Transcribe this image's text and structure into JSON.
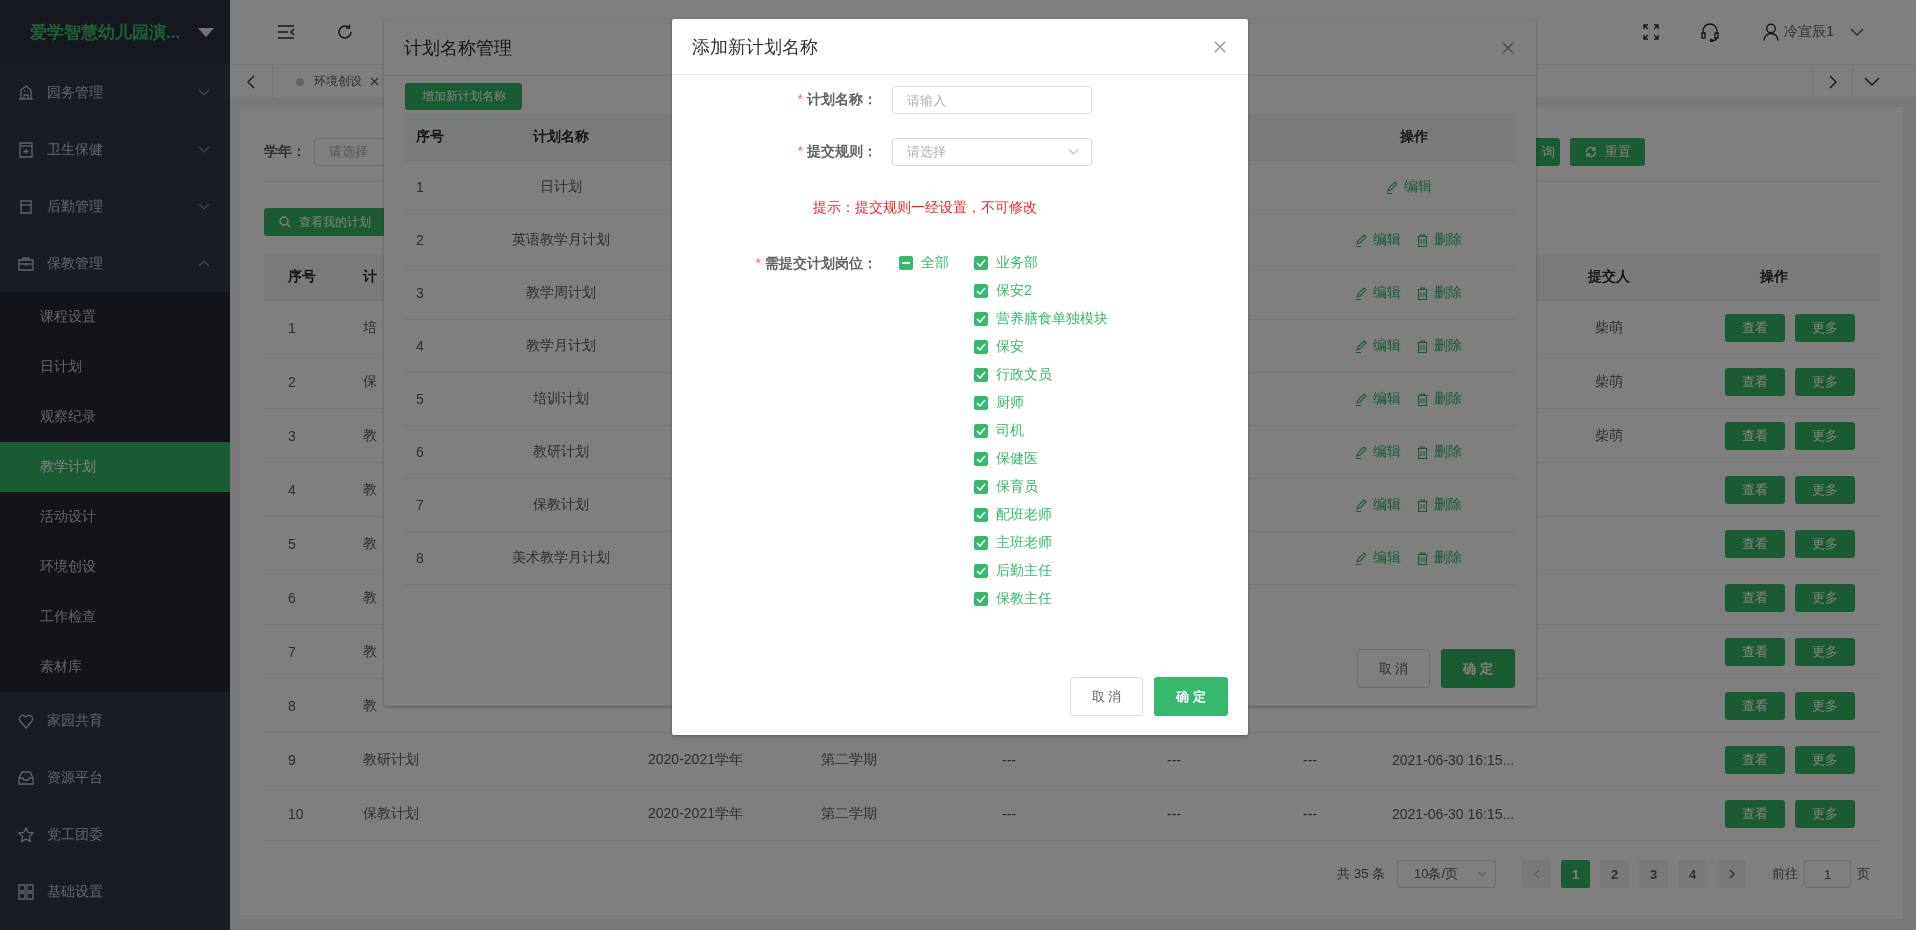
{
  "sidebar": {
    "logo": "爱学智慧幼儿园演...",
    "items": [
      {
        "label": "园务管理",
        "kind": "submenu",
        "expanded": false
      },
      {
        "label": "卫生保健",
        "kind": "submenu",
        "expanded": false
      },
      {
        "label": "后勤管理",
        "kind": "submenu",
        "expanded": false
      },
      {
        "label": "保教管理",
        "kind": "submenu",
        "expanded": true,
        "children": [
          {
            "label": "课程设置",
            "selected": false
          },
          {
            "label": "日计划",
            "selected": false
          },
          {
            "label": "观察纪录",
            "selected": false
          },
          {
            "label": "教学计划",
            "selected": true
          },
          {
            "label": "活动设计",
            "selected": false
          },
          {
            "label": "环境创设",
            "selected": false
          },
          {
            "label": "工作检查",
            "selected": false
          },
          {
            "label": "素材库",
            "selected": false
          }
        ]
      },
      {
        "label": "家园共育",
        "kind": "link"
      },
      {
        "label": "资源平台",
        "kind": "link"
      },
      {
        "label": "党工团委",
        "kind": "link"
      },
      {
        "label": "基础设置",
        "kind": "link"
      }
    ]
  },
  "topbar": {
    "user": "冷宣辰1"
  },
  "tabs": [
    {
      "label": "环境创设",
      "selected": false
    }
  ],
  "filter": {
    "label": "学年：",
    "placeholder": "请选择",
    "buttons": [
      {
        "kind": "search",
        "label": "询"
      },
      {
        "kind": "reset",
        "label": "重置"
      }
    ]
  },
  "my_plans_button": "查看我的计划",
  "table": {
    "columns": {
      "index": "序号",
      "name": "计",
      "submitter": "提交人",
      "actions": "操作"
    },
    "rows": [
      {
        "index": "1",
        "name": "培",
        "submitter": "柴萌",
        "actions": [
          "查看",
          "更多"
        ]
      },
      {
        "index": "2",
        "name": "保",
        "submitter": "柴萌",
        "actions": [
          "查看",
          "更多"
        ]
      },
      {
        "index": "3",
        "name": "教",
        "submitter": "柴萌",
        "actions": [
          "查看",
          "更多"
        ]
      },
      {
        "index": "4",
        "name": "教",
        "actions": [
          "查看",
          "更多"
        ]
      },
      {
        "index": "5",
        "name": "教",
        "actions": [
          "查看",
          "更多"
        ]
      },
      {
        "index": "6",
        "name": "教",
        "actions": [
          "查看",
          "更多"
        ]
      },
      {
        "index": "7",
        "name": "教",
        "actions": [
          "查看",
          "更多"
        ]
      },
      {
        "index": "8",
        "name": "教",
        "actions": [
          "查看",
          "更多"
        ]
      },
      {
        "index": "9",
        "name": "教研计划",
        "year": "2020-2021学年",
        "term": "第二学期",
        "column_5": "---",
        "column_6": "---",
        "column_7": "---",
        "submitted_at": "2021-06-30 16:15...",
        "actions": [
          "查看",
          "更多"
        ]
      },
      {
        "index": "10",
        "name": "保教计划",
        "year": "2020-2021学年",
        "term": "第二学期",
        "column_5": "---",
        "column_6": "---",
        "column_7": "---",
        "submitted_at": "2021-06-30 16:15...",
        "actions": [
          "查看",
          "更多"
        ]
      }
    ]
  },
  "pagination": {
    "total": "共 35 条",
    "page_size": "10条/页",
    "pages": [
      {
        "label": "1",
        "selected": true
      },
      {
        "label": "2",
        "selected": false
      },
      {
        "label": "3",
        "selected": false
      },
      {
        "label": "4",
        "selected": false
      }
    ],
    "goto_label": "前往",
    "goto_value": "1",
    "page_suffix": "页"
  },
  "plan_dialog": {
    "title": "计划名称管理",
    "add_button": "增加新计划名称",
    "columns": {
      "index": "序号",
      "name": "计划名称",
      "actions": "操作"
    },
    "rows": [
      {
        "index": "1",
        "name": "日计划",
        "actions": [
          {
            "kind": "edit",
            "label": "编辑"
          }
        ]
      },
      {
        "index": "2",
        "name": "英语教学月计划",
        "actions": [
          {
            "kind": "edit",
            "label": "编辑"
          },
          {
            "kind": "delete",
            "label": "删除"
          }
        ]
      },
      {
        "index": "3",
        "name": "教学周计划",
        "actions": [
          {
            "kind": "edit",
            "label": "编辑"
          },
          {
            "kind": "delete",
            "label": "删除"
          }
        ]
      },
      {
        "index": "4",
        "name": "教学月计划",
        "actions": [
          {
            "kind": "edit",
            "label": "编辑"
          },
          {
            "kind": "delete",
            "label": "删除"
          }
        ]
      },
      {
        "index": "5",
        "name": "培训计划",
        "actions": [
          {
            "kind": "edit",
            "label": "编辑"
          },
          {
            "kind": "delete",
            "label": "删除"
          }
        ]
      },
      {
        "index": "6",
        "name": "教研计划",
        "actions": [
          {
            "kind": "edit",
            "label": "编辑"
          },
          {
            "kind": "delete",
            "label": "删除"
          }
        ]
      },
      {
        "index": "7",
        "name": "保教计划",
        "actions": [
          {
            "kind": "edit",
            "label": "编辑"
          },
          {
            "kind": "delete",
            "label": "删除"
          }
        ]
      },
      {
        "index": "8",
        "name": "美术教学月计划",
        "actions": [
          {
            "kind": "edit",
            "label": "编辑"
          },
          {
            "kind": "delete",
            "label": "删除"
          }
        ]
      }
    ],
    "cancel": "取 消",
    "ok": "确 定"
  },
  "add_dialog": {
    "title": "添加新计划名称",
    "fields": [
      {
        "kind": "input",
        "required_mark": "*",
        "label": "计划名称：",
        "placeholder": "请输入"
      },
      {
        "kind": "select",
        "required_mark": "*",
        "label": "提交规则：",
        "placeholder": "请选择"
      }
    ],
    "hint": "提示：提交规则一经设置，不可修改",
    "positions": {
      "required_mark": "*",
      "label": "需提交计划岗位：",
      "all": {
        "label": "全部",
        "indeterminate": true
      },
      "options": [
        {
          "label": "业务部",
          "checked": true
        },
        {
          "label": "保安2",
          "checked": true
        },
        {
          "label": "营养膳食单独模块",
          "checked": true
        },
        {
          "label": "保安",
          "checked": true
        },
        {
          "label": "行政文员",
          "checked": true
        },
        {
          "label": "厨师",
          "checked": true
        },
        {
          "label": "司机",
          "checked": true
        },
        {
          "label": "保健医",
          "checked": true
        },
        {
          "label": "保育员",
          "checked": true
        },
        {
          "label": "配班老师",
          "checked": true
        },
        {
          "label": "主班老师",
          "checked": true
        },
        {
          "label": "后勤主任",
          "checked": true
        },
        {
          "label": "保教主任",
          "checked": true
        }
      ]
    },
    "cancel": "取 消",
    "ok": "确 定"
  }
}
